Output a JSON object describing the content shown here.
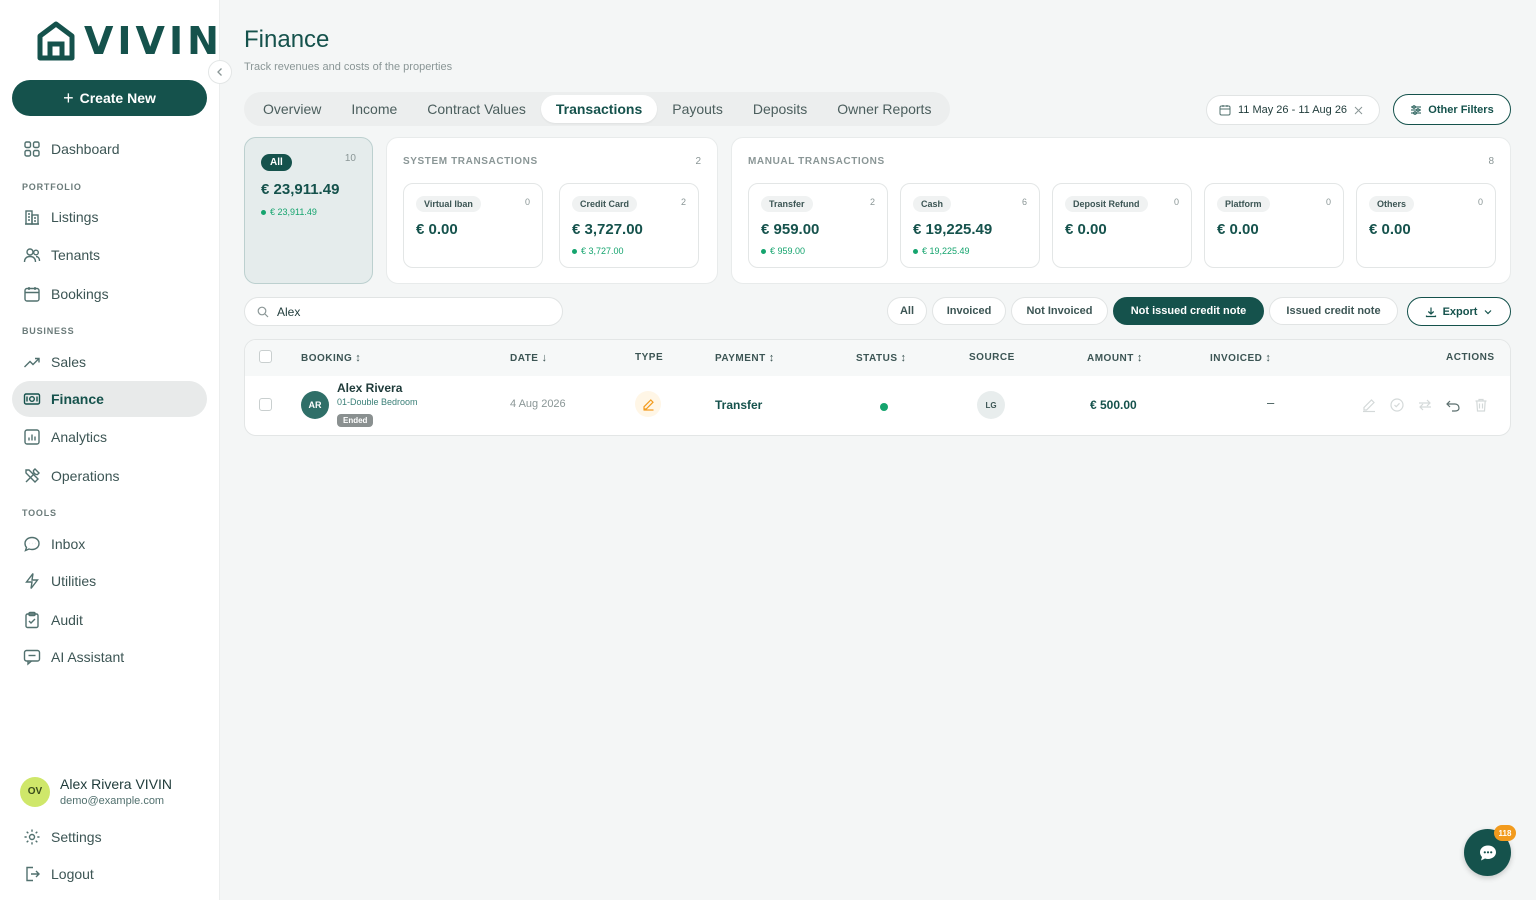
{
  "app": {
    "logo_text": "VIVIN"
  },
  "sidebar": {
    "create_label": "Create New",
    "dashboard": "Dashboard",
    "sections": {
      "portfolio": "PORTFOLIO",
      "business": "BUSINESS",
      "tools": "TOOLS"
    },
    "items": {
      "listings": "Listings",
      "tenants": "Tenants",
      "bookings": "Bookings",
      "sales": "Sales",
      "finance": "Finance",
      "analytics": "Analytics",
      "operations": "Operations",
      "inbox": "Inbox",
      "utilities": "Utilities",
      "audit": "Audit",
      "ai_assistant": "AI Assistant"
    },
    "user": {
      "initials": "OV",
      "name": "Alex Rivera VIVIN",
      "email": "demo@example.com"
    },
    "settings": "Settings",
    "logout": "Logout"
  },
  "header": {
    "title": "Finance",
    "subtitle": "Track revenues and costs of the properties"
  },
  "tabs": [
    "Overview",
    "Income",
    "Contract Values",
    "Transactions",
    "Payouts",
    "Deposits",
    "Owner Reports"
  ],
  "active_tab": "Transactions",
  "date_range": "11 May 26 - 11 Aug 26",
  "other_filters_label": "Other Filters",
  "summary": {
    "all": {
      "label": "All",
      "count": "10",
      "amount": "€ 23,911.49",
      "sub_amount": "€ 23,911.49"
    },
    "system": {
      "title": "SYSTEM TRANSACTIONS",
      "count": "2",
      "cards": [
        {
          "label": "Virtual Iban",
          "count": "0",
          "amount": "€ 0.00",
          "sub_amount": ""
        },
        {
          "label": "Credit Card",
          "count": "2",
          "amount": "€ 3,727.00",
          "sub_amount": "€ 3,727.00"
        }
      ]
    },
    "manual": {
      "title": "MANUAL TRANSACTIONS",
      "count": "8",
      "cards": [
        {
          "label": "Transfer",
          "count": "2",
          "amount": "€ 959.00",
          "sub_amount": "€ 959.00"
        },
        {
          "label": "Cash",
          "count": "6",
          "amount": "€ 19,225.49",
          "sub_amount": "€ 19,225.49"
        },
        {
          "label": "Deposit Refund",
          "count": "0",
          "amount": "€ 0.00",
          "sub_amount": ""
        },
        {
          "label": "Platform",
          "count": "0",
          "amount": "€ 0.00",
          "sub_amount": ""
        },
        {
          "label": "Others",
          "count": "0",
          "amount": "€ 0.00",
          "sub_amount": ""
        }
      ]
    }
  },
  "search": {
    "value": "Alex"
  },
  "filter_chips": [
    "All",
    "Invoiced",
    "Not Invoiced",
    "Not issued credit note",
    "Issued credit note"
  ],
  "active_chip": "Not issued credit note",
  "export_label": "Export",
  "table": {
    "headers": {
      "booking": "BOOKING",
      "date": "DATE",
      "type": "TYPE",
      "payment": "PAYMENT",
      "status": "STATUS",
      "source": "SOURCE",
      "amount": "AMOUNT",
      "invoiced": "INVOICED",
      "actions": "ACTIONS"
    },
    "rows": [
      {
        "initials": "AR",
        "name": "Alex Rivera",
        "room": "01-Double Bedroom",
        "booking_status": "Ended",
        "date": "4 Aug 2026",
        "payment": "Transfer",
        "source": "LG",
        "amount": "€ 500.00",
        "invoiced": "–"
      }
    ]
  },
  "chat": {
    "badge": "118"
  },
  "colors": {
    "brand": "#15524c",
    "success": "#15a46e",
    "badge": "#f29b1e"
  }
}
